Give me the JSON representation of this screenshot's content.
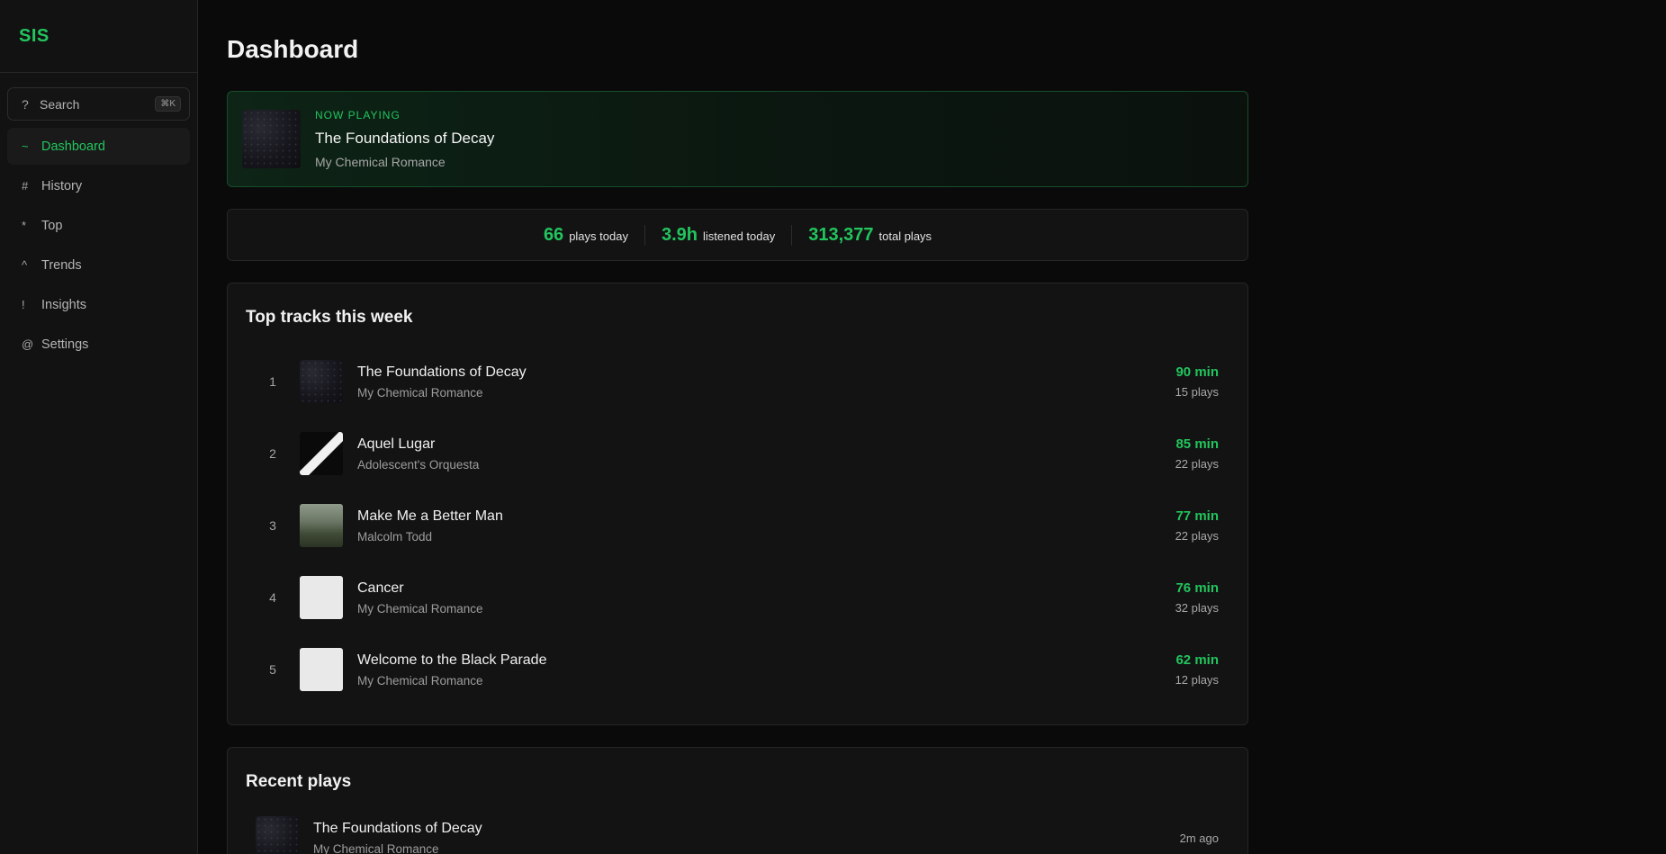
{
  "sidebar": {
    "brand": "SIS",
    "search": {
      "glyph": "?",
      "label": "Search",
      "shortcut": "⌘K"
    },
    "items": [
      {
        "glyph": "~",
        "label": "Dashboard"
      },
      {
        "glyph": "#",
        "label": "History"
      },
      {
        "glyph": "*",
        "label": "Top"
      },
      {
        "glyph": "^",
        "label": "Trends"
      },
      {
        "glyph": "!",
        "label": "Insights"
      },
      {
        "glyph": "@",
        "label": "Settings"
      }
    ],
    "active_item": "Dashboard"
  },
  "main": {
    "title": "Dashboard",
    "now_playing": {
      "label": "NOW PLAYING",
      "title": "The Foundations of Decay",
      "artist": "My Chemical Romance"
    },
    "stats": [
      {
        "value": "66",
        "label": "plays today"
      },
      {
        "value": "3.9h",
        "label": "listened today"
      },
      {
        "value": "313,377",
        "label": "total plays"
      }
    ],
    "top_tracks": {
      "title": "Top tracks this week",
      "items": [
        {
          "rank": "1",
          "title": "The Foundations of Decay",
          "artist": "My Chemical Romance",
          "minutes": "90 min",
          "plays": "15 plays"
        },
        {
          "rank": "2",
          "title": "Aquel Lugar",
          "artist": "Adolescent's Orquesta",
          "minutes": "85 min",
          "plays": "22 plays"
        },
        {
          "rank": "3",
          "title": "Make Me a Better Man",
          "artist": "Malcolm Todd",
          "minutes": "77 min",
          "plays": "22 plays"
        },
        {
          "rank": "4",
          "title": "Cancer",
          "artist": "My Chemical Romance",
          "minutes": "76 min",
          "plays": "32 plays"
        },
        {
          "rank": "5",
          "title": "Welcome to the Black Parade",
          "artist": "My Chemical Romance",
          "minutes": "62 min",
          "plays": "12 plays"
        }
      ]
    },
    "recent_plays": {
      "title": "Recent plays",
      "items": [
        {
          "title": "The Foundations of Decay",
          "artist": "My Chemical Romance",
          "ago": "2m ago"
        }
      ]
    }
  },
  "colors": {
    "accent": "#22c55e",
    "background": "#0a0a0a",
    "surface": "#131313"
  }
}
